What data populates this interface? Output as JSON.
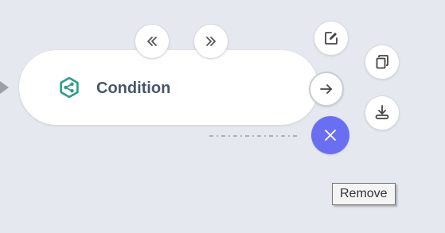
{
  "node": {
    "label": "Condition",
    "icon": "condition-icon",
    "icon_color": "#2a9d8f"
  },
  "toolbar": {
    "collapse_left_icon": "double-chevron-left-icon",
    "collapse_right_icon": "double-chevron-right-icon",
    "edit_icon": "edit-icon",
    "copy_icon": "copy-icon",
    "next_icon": "arrow-right-icon",
    "save_icon": "download-icon",
    "remove_icon": "close-icon",
    "remove_color": "#6a6ff2"
  },
  "tooltip": {
    "text": "Remove"
  }
}
